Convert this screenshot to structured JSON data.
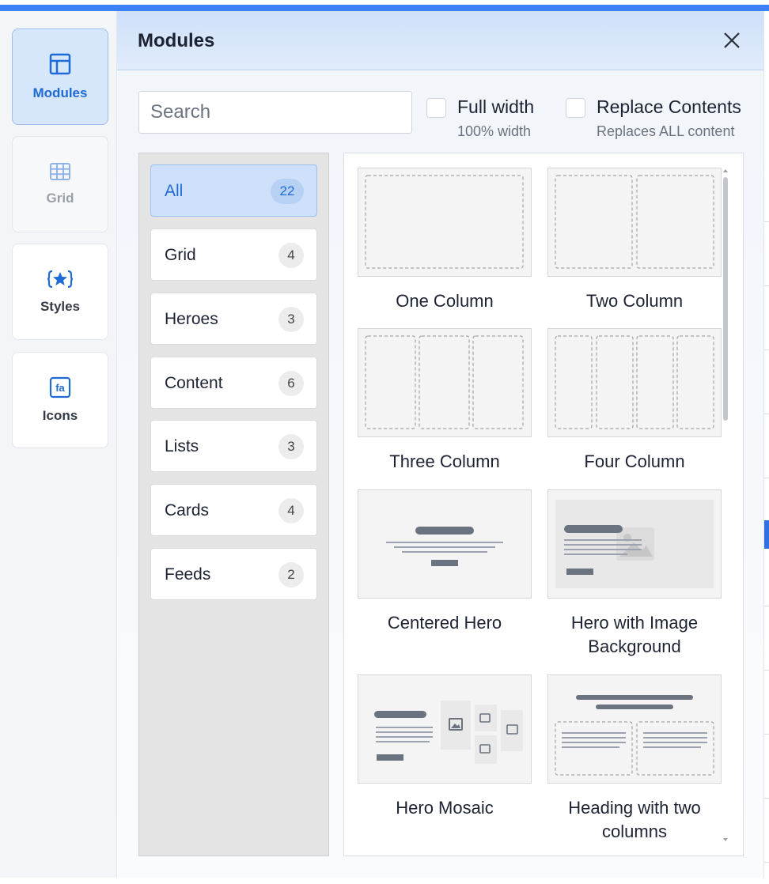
{
  "rail": {
    "items": [
      {
        "label": "Modules",
        "icon": "layout-icon",
        "state": "active"
      },
      {
        "label": "Grid",
        "icon": "grid-icon",
        "state": "disabled"
      },
      {
        "label": "Styles",
        "icon": "star-braces-icon",
        "state": "normal"
      },
      {
        "label": "Icons",
        "icon": "fa-icon",
        "state": "normal"
      }
    ]
  },
  "panel": {
    "title": "Modules",
    "search_placeholder": "Search",
    "options": [
      {
        "label": "Full width",
        "hint": "100% width",
        "checked": false
      },
      {
        "label": "Replace Contents",
        "hint": "Replaces ALL content",
        "checked": false
      }
    ]
  },
  "categories": [
    {
      "name": "All",
      "count": "22",
      "active": true
    },
    {
      "name": "Grid",
      "count": "4"
    },
    {
      "name": "Heroes",
      "count": "3"
    },
    {
      "name": "Content",
      "count": "6"
    },
    {
      "name": "Lists",
      "count": "3"
    },
    {
      "name": "Cards",
      "count": "4"
    },
    {
      "name": "Feeds",
      "count": "2"
    }
  ],
  "modules": [
    {
      "label": "One Column"
    },
    {
      "label": "Two Column"
    },
    {
      "label": "Three Column"
    },
    {
      "label": "Four Column"
    },
    {
      "label": "Centered Hero"
    },
    {
      "label": "Hero with Image Background"
    },
    {
      "label": "Hero Mosaic"
    },
    {
      "label": "Heading with two columns"
    }
  ],
  "colors": {
    "accent": "#1f6bd6",
    "topbar": "#3b82f6",
    "active_bg": "#d6e6fb"
  }
}
